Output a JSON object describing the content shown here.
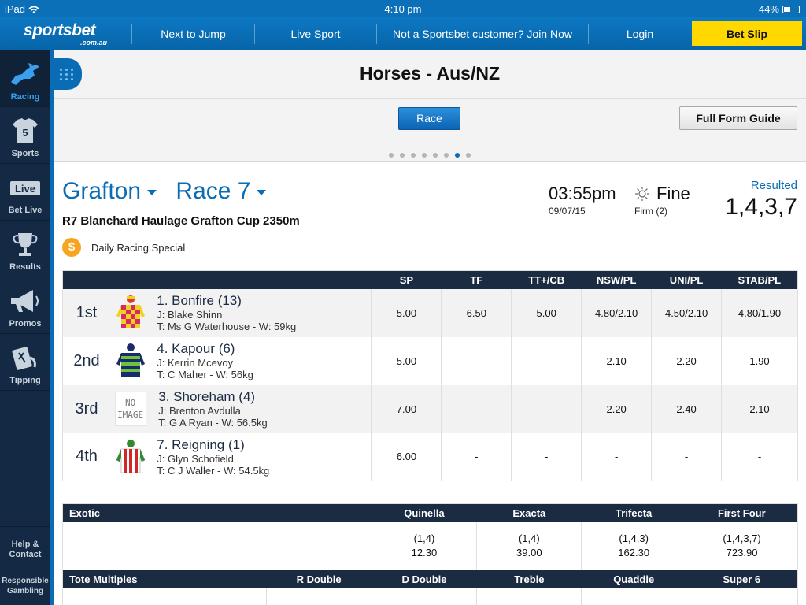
{
  "status": {
    "device": "iPad",
    "time": "4:10 pm",
    "battery": "44%",
    "battery_level": 0.44
  },
  "nav": {
    "logo_main": "sportsbet",
    "logo_sub": ".com.au",
    "next_to_jump": "Next to Jump",
    "live_sport": "Live Sport",
    "join": "Not a Sportsbet customer? Join Now",
    "login": "Login",
    "bet_slip": "Bet Slip"
  },
  "sidebar": {
    "items": [
      {
        "label": "Racing",
        "icon": "horse-icon",
        "active": true
      },
      {
        "label": "Sports",
        "icon": "jersey-icon",
        "active": false
      },
      {
        "label": "Bet Live",
        "icon": "live-badge-icon",
        "badge": "Live",
        "active": false
      },
      {
        "label": "Results",
        "icon": "trophy-icon",
        "active": false
      },
      {
        "label": "Promos",
        "icon": "megaphone-icon",
        "active": false
      },
      {
        "label": "Tipping",
        "icon": "tipping-icon",
        "active": false
      }
    ],
    "help_contact": "Help & Contact",
    "responsible": "Responsible Gambling"
  },
  "page": {
    "title": "Horses - Aus/NZ",
    "race_button": "Race",
    "form_guide_button": "Full Form Guide",
    "pager_count": 8,
    "pager_active": 6
  },
  "race": {
    "venue": "Grafton",
    "race_number": "Race 7",
    "name": "R7 Blanchard Haulage Grafton Cup 2350m",
    "special": "Daily Racing Special",
    "special_icon": "$",
    "time": "03:55pm",
    "date": "09/07/15",
    "weather": "Fine",
    "track": "Firm (2)",
    "status": "Resulted",
    "result": "1,4,3,7"
  },
  "results": {
    "columns": [
      "SP",
      "TF",
      "TT+/CB",
      "NSW/PL",
      "UNI/PL",
      "STAB/PL"
    ],
    "rows": [
      {
        "pos": "1st",
        "name": "1. Bonfire (13)",
        "jockey": "J: Blake Shinn",
        "trainer": "T: Ms G Waterhouse - W: 59kg",
        "silk": "bonfire",
        "values": [
          "5.00",
          "6.50",
          "5.00",
          "4.80/2.10",
          "4.50/2.10",
          "4.80/1.90"
        ]
      },
      {
        "pos": "2nd",
        "name": "4. Kapour (6)",
        "jockey": "J: Kerrin Mcevoy",
        "trainer": "T: C Maher - W: 56kg",
        "silk": "kapour",
        "values": [
          "5.00",
          "-",
          "-",
          "2.10",
          "2.20",
          "1.90"
        ]
      },
      {
        "pos": "3rd",
        "name": "3. Shoreham (4)",
        "jockey": "J: Brenton Avdulla",
        "trainer": "T: G A Ryan - W: 56.5kg",
        "silk": "none",
        "values": [
          "7.00",
          "-",
          "-",
          "2.20",
          "2.40",
          "2.10"
        ]
      },
      {
        "pos": "4th",
        "name": "7. Reigning (1)",
        "jockey": "J: Glyn Schofield",
        "trainer": "T: C J Waller - W: 54.5kg",
        "silk": "reigning",
        "values": [
          "6.00",
          "-",
          "-",
          "-",
          "-",
          "-"
        ]
      }
    ],
    "no_image_line1": "NO",
    "no_image_line2": "IMAGE"
  },
  "exotics": {
    "header": "Exotic",
    "columns": [
      {
        "label": "Quinella",
        "combo": "(1,4)",
        "dividend": "12.30"
      },
      {
        "label": "Exacta",
        "combo": "(1,4)",
        "dividend": "39.00"
      },
      {
        "label": "Trifecta",
        "combo": "(1,4,3)",
        "dividend": "162.30"
      },
      {
        "label": "First Four",
        "combo": "(1,4,3,7)",
        "dividend": "723.90"
      }
    ]
  },
  "tote": {
    "header": "Tote Multiples",
    "columns": [
      "R Double",
      "D Double",
      "Treble",
      "Quaddie",
      "Super 6"
    ]
  },
  "colors": {
    "brand_blue": "#0a6cb4",
    "nav_dark": "#1a2b42",
    "bet_slip_yellow": "#ffd800",
    "sidebar": "#142a44"
  }
}
